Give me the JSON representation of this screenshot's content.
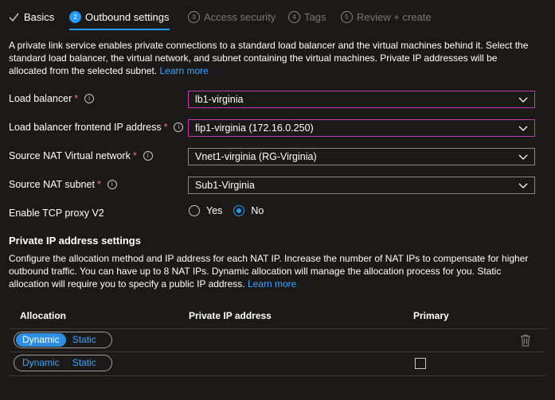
{
  "tabs": [
    {
      "label": "Basics",
      "state": "done"
    },
    {
      "num": "2",
      "label": "Outbound settings",
      "state": "active"
    },
    {
      "num": "3",
      "label": "Access security",
      "state": "disabled"
    },
    {
      "num": "4",
      "label": "Tags",
      "state": "disabled"
    },
    {
      "num": "5",
      "label": "Review + create",
      "state": "disabled"
    }
  ],
  "intro": {
    "text": "A private link service enables private connections to a standard load balancer and the virtual machines behind it. Select the standard load balancer, the virtual network, and subnet containing the virtual machines. Private IP addresses will be allocated from the selected subnet.",
    "link": "Learn more"
  },
  "fields": {
    "load_balancer": {
      "label": "Load balancer",
      "required": "*",
      "value": "lb1-virginia"
    },
    "frontend_ip": {
      "label": "Load balancer frontend IP address",
      "required": "*",
      "value": "fip1-virginia (172.16.0.250)"
    },
    "vnet": {
      "label": "Source NAT Virtual network",
      "required": "*",
      "value": "Vnet1-virginia (RG-Virginia)"
    },
    "subnet": {
      "label": "Source NAT subnet",
      "required": "*",
      "value": "Sub1-Virginia"
    },
    "tcp_proxy": {
      "label": "Enable TCP proxy V2",
      "yes": "Yes",
      "no": "No",
      "selected": "No"
    }
  },
  "ip_settings": {
    "title": "Private IP address settings",
    "text": "Configure the allocation method and IP address for each NAT IP. Increase the number of NAT IPs to compensate for higher outbound traffic. You can have up to 8 NAT IPs. Dynamic allocation will manage the allocation process for you. Static allocation will require you to specify a public IP address.",
    "link": "Learn more",
    "columns": [
      "Allocation",
      "Private IP address",
      "Primary"
    ],
    "rows": [
      {
        "dynamic": "Dynamic",
        "static": "Static",
        "selected": "Dynamic"
      },
      {
        "dynamic": "Dynamic",
        "static": "Static",
        "selected": "none"
      }
    ]
  },
  "colors": {
    "accent": "#2899f5",
    "link": "#3ca4ff",
    "focus_border": "#c239b3",
    "required": "#f1707b"
  }
}
